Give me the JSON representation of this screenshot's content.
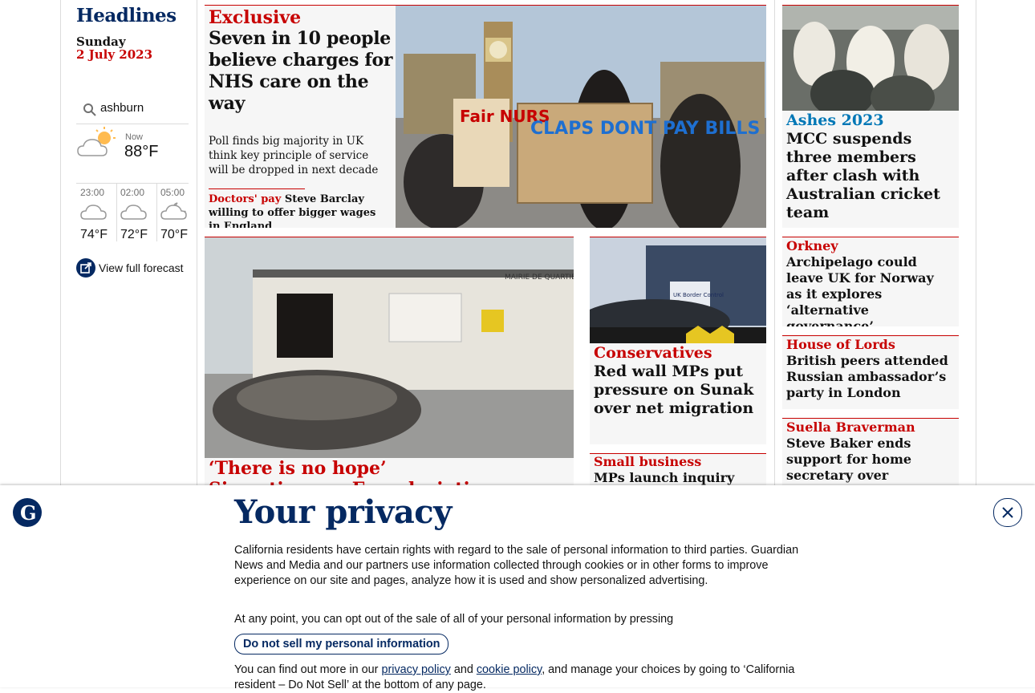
{
  "left": {
    "title": "Headlines",
    "day": "Sunday",
    "date": "2 July 2023",
    "weather": {
      "location": "ashburn",
      "now_label": "Now",
      "now_temp": "88°F",
      "forecast": [
        {
          "time": "23:00",
          "temp": "74°F",
          "icon": "cloud-icon"
        },
        {
          "time": "02:00",
          "temp": "72°F",
          "icon": "cloud-icon"
        },
        {
          "time": "05:00",
          "temp": "70°F",
          "icon": "cloud-moon-icon"
        }
      ],
      "view_full": "View full forecast"
    }
  },
  "main": {
    "kicker": "Exclusive",
    "headline": "Seven in 10 people believe charges for NHS care on the way",
    "standfirst": "Poll finds big majority in UK think key principle of service will be dropped in next decade",
    "related_kicker": "Doctors' pay",
    "related_text": "Steve Barclay willing to offer bigger wages in England",
    "photo_sign_1": "Fair NURS",
    "photo_sign_2": "CLAPS DONT PAY BILLS"
  },
  "france": {
    "kicker": "‘There is no hope’",
    "headline": "Six nations as French rioting continues",
    "photo_sign": "MAIRIE DE QUARTIER"
  },
  "conservatives": {
    "kicker": "Conservatives",
    "headline": "Red wall MPs put pressure on Sunak over net migration",
    "photo_sign": "UK Border Control"
  },
  "small_business": {
    "kicker": "Small business",
    "headline": "MPs launch inquiry into"
  },
  "ashes": {
    "kicker": "Ashes 2023",
    "headline": "MCC suspends three members after clash with Australian cricket team"
  },
  "orkney": {
    "kicker": "Orkney",
    "headline": "Archipelago could leave UK for Norway as it explores ‘alternative governance’"
  },
  "lords": {
    "kicker": "House of Lords",
    "headline": "British peers attended Russian ambassador’s party in London"
  },
  "braverman": {
    "kicker": "Suella Braverman",
    "headline": "Steve Baker ends support for home secretary over grooming gangs rhetoric,"
  },
  "privacy": {
    "title": "Your privacy",
    "p1": "California residents have certain rights with regard to the sale of personal information to third parties. Guardian News and Media and our partners use information collected through cookies or in other forms to improve experience on our site and pages, analyze how it is used and show personalized advertising.",
    "p2": "At any point, you can opt out of the sale of all of your personal information by pressing",
    "button": "Do not sell my personal information",
    "p3_start": "You can find out more in our",
    "privacy_link": "privacy policy",
    "and": "and",
    "cookie_link": "cookie policy",
    "p3_end": ", and manage your choices by going to ‘California resident – Do Not Sell’ at the bottom of any page."
  },
  "colors": {
    "brand": "#052962",
    "news_red": "#c70000",
    "ashes_blue": "#0077b6"
  }
}
